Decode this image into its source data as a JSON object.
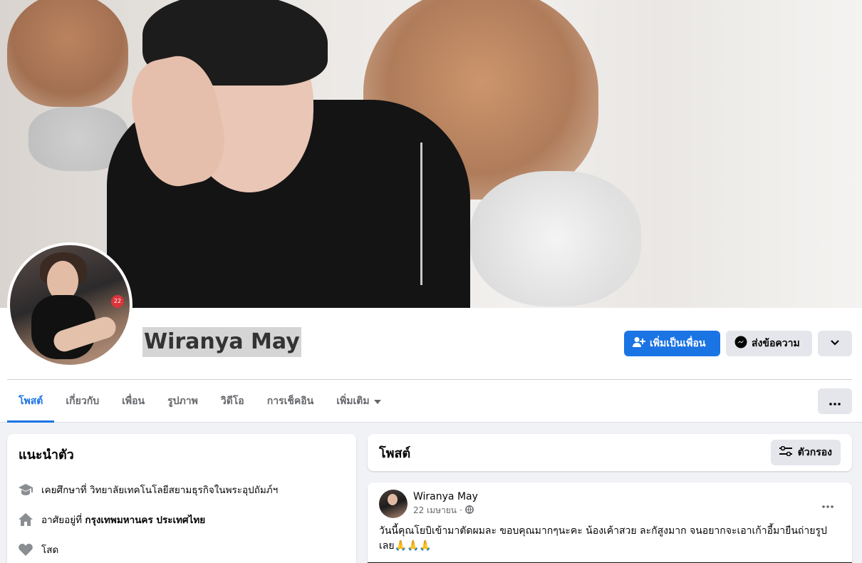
{
  "profile": {
    "name": "Wiranya May",
    "actions": {
      "add_friend": "เพิ่มเป็นเพื่อน",
      "message": "ส่งข้อความ"
    },
    "avatar_badge": "22"
  },
  "tabs": [
    {
      "label": "โพสต์",
      "active": true
    },
    {
      "label": "เกี่ยวกับ"
    },
    {
      "label": "เพื่อน"
    },
    {
      "label": "รูปภาพ"
    },
    {
      "label": "วิดีโอ"
    },
    {
      "label": "การเช็คอิน"
    },
    {
      "label": "เพิ่มเติม"
    }
  ],
  "intro": {
    "title": "แนะนำตัว",
    "education_prefix": "เคยศึกษาที่",
    "education": "วิทยาลัยเทคโนโลยีสยามธุรกิจในพระอุปถัมภ์ฯ",
    "lives_prefix": "อาศัยอยู่ที่",
    "lives": "กรุงเทพมหานคร ประเทศไทย",
    "relationship": "โสด"
  },
  "posts": {
    "title": "โพสต์",
    "filter_label": "ตัวกรอง"
  },
  "post": {
    "author": "Wiranya May",
    "date": "22 เมษายน",
    "separator": "·",
    "text": "วันนี้คุณโยบิเข้ามาตัดผมละ ขอบคุณมากๆนะคะ น้องเค้าสวย ละกัสูงมาก จนอยากจะเอาเก้าอี้มายืนถ่ายรูปเลย🙏🙏🙏"
  },
  "colors": {
    "accent": "#1b74e4",
    "button_gray": "#e4e6eb",
    "text_secondary": "#65676b"
  }
}
